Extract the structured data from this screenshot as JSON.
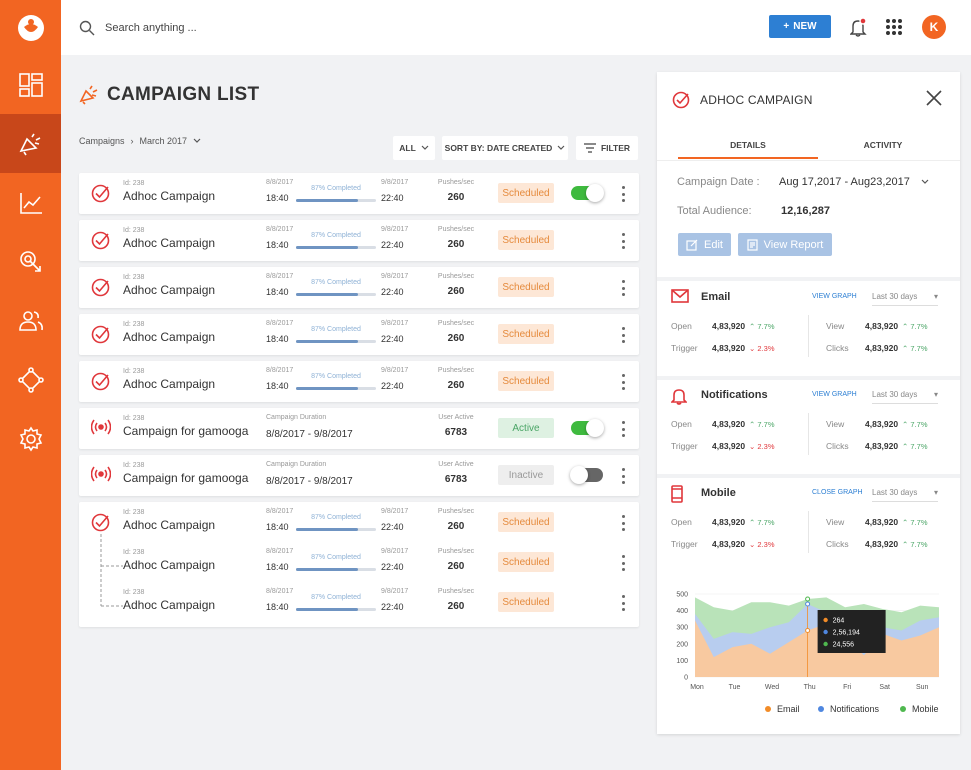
{
  "search": {
    "placeholder": "Search anything ..."
  },
  "header": {
    "new_label": "NEW",
    "avatar_initial": "K"
  },
  "page": {
    "title": "CAMPAIGN LIST"
  },
  "breadcrumb": {
    "root": "Campaigns",
    "current": "March 2017"
  },
  "filters": {
    "all_label": "ALL",
    "sort_label": "SORT BY: DATE CREATED",
    "filter_label": "FILTER"
  },
  "rows": [
    {
      "id": "Id: 238",
      "name": "Adhoc Campaign",
      "start_date": "8/8/2017",
      "start_time": "18:40",
      "progress_text": "87% Completed",
      "progress": 0.78,
      "end_date": "9/8/2017",
      "end_time": "22:40",
      "metric_label": "Pushes/sec",
      "metric_value": "260",
      "status": "Scheduled"
    },
    {
      "id": "Id: 238",
      "name": "Adhoc Campaign",
      "start_date": "8/8/2017",
      "start_time": "18:40",
      "progress_text": "87% Completed",
      "progress": 0.78,
      "end_date": "9/8/2017",
      "end_time": "22:40",
      "metric_label": "Pushes/sec",
      "metric_value": "260",
      "status": "Scheduled"
    },
    {
      "id": "Id: 238",
      "name": "Adhoc Campaign",
      "start_date": "8/8/2017",
      "start_time": "18:40",
      "progress_text": "87% Completed",
      "progress": 0.78,
      "end_date": "9/8/2017",
      "end_time": "22:40",
      "metric_label": "Pushes/sec",
      "metric_value": "260",
      "status": "Scheduled"
    },
    {
      "id": "Id: 238",
      "name": "Adhoc Campaign",
      "start_date": "8/8/2017",
      "start_time": "18:40",
      "progress_text": "87% Completed",
      "progress": 0.78,
      "end_date": "9/8/2017",
      "end_time": "22:40",
      "metric_label": "Pushes/sec",
      "metric_value": "260",
      "status": "Scheduled"
    },
    {
      "id": "Id: 238",
      "name": "Adhoc Campaign",
      "start_date": "8/8/2017",
      "start_time": "18:40",
      "progress_text": "87% Completed",
      "progress": 0.78,
      "end_date": "9/8/2017",
      "end_time": "22:40",
      "metric_label": "Pushes/sec",
      "metric_value": "260",
      "status": "Scheduled"
    },
    {
      "id": "Id: 238",
      "name": "Campaign for gamooga",
      "duration_label": "Campaign Duration",
      "duration": "8/8/2017 - 9/8/2017",
      "metric_label": "User Active",
      "metric_value": "6783",
      "status": "Active"
    },
    {
      "id": "Id: 238",
      "name": "Campaign for gamooga",
      "duration_label": "Campaign Duration",
      "duration": "8/8/2017 - 9/8/2017",
      "metric_label": "User Active",
      "metric_value": "6783",
      "status": "Inactive"
    }
  ],
  "group_rows": [
    {
      "id": "Id: 238",
      "name": "Adhoc Campaign",
      "start_date": "8/8/2017",
      "start_time": "18:40",
      "progress_text": "87% Completed",
      "progress": 0.78,
      "end_date": "9/8/2017",
      "end_time": "22:40",
      "metric_label": "Pushes/sec",
      "metric_value": "260",
      "status": "Scheduled"
    },
    {
      "id": "Id: 238",
      "name": "Adhoc Campaign",
      "start_date": "8/8/2017",
      "start_time": "18:40",
      "progress_text": "87% Completed",
      "progress": 0.78,
      "end_date": "9/8/2017",
      "end_time": "22:40",
      "metric_label": "Pushes/sec",
      "metric_value": "260",
      "status": "Scheduled"
    },
    {
      "id": "Id: 238",
      "name": "Adhoc Campaign",
      "start_date": "8/8/2017",
      "start_time": "18:40",
      "progress_text": "87% Completed",
      "progress": 0.78,
      "end_date": "9/8/2017",
      "end_time": "22:40",
      "metric_label": "Pushes/sec",
      "metric_value": "260",
      "status": "Scheduled"
    }
  ],
  "panel": {
    "title": "ADHOC CAMPAIGN",
    "tab_details": "DETAILS",
    "tab_activity": "ACTIVITY",
    "campaign_date_label": "Campaign Date :",
    "campaign_date_value": "Aug 17,2017 - Aug23,2017",
    "audience_label": "Total Audience:",
    "audience_value": "12,16,287",
    "edit_label": "Edit",
    "report_label": "View Report",
    "sections": [
      {
        "name": "Email",
        "link": "VIEW GRAPH",
        "period": "Last 30 days",
        "metrics": [
          {
            "label": "Open",
            "value": "4,83,920",
            "change": "7.7%"
          },
          {
            "label": "Trigger",
            "value": "4,83,920",
            "change": "2.3%"
          },
          {
            "label": "View",
            "value": "4,83,920",
            "change": "7.7%"
          },
          {
            "label": "Clicks",
            "value": "4,83,920",
            "change": "7.7%"
          }
        ]
      },
      {
        "name": "Notifications",
        "link": "VIEW GRAPH",
        "period": "Last 30 days",
        "metrics": [
          {
            "label": "Open",
            "value": "4,83,920",
            "change": "7.7%"
          },
          {
            "label": "Trigger",
            "value": "4,83,920",
            "change": "2.3%"
          },
          {
            "label": "View",
            "value": "4,83,920",
            "change": "7.7%"
          },
          {
            "label": "Clicks",
            "value": "4,83,920",
            "change": "7.7%"
          }
        ]
      },
      {
        "name": "Mobile",
        "link": "CLOSE GRAPH",
        "period": "Last 30 days",
        "metrics": [
          {
            "label": "Open",
            "value": "4,83,920",
            "change": "7.7%"
          },
          {
            "label": "Trigger",
            "value": "4,83,920",
            "change": "2.3%"
          },
          {
            "label": "View",
            "value": "4,83,920",
            "change": "7.7%"
          },
          {
            "label": "Clicks",
            "value": "4,83,920",
            "change": "7.7%"
          }
        ]
      }
    ]
  },
  "chart_data": {
    "type": "area",
    "categories": [
      "Mon",
      "Tue",
      "Wed",
      "Thu",
      "Fri",
      "Sat",
      "Sun"
    ],
    "y_ticks": [
      "0",
      "100",
      "200",
      "300",
      "400",
      "500"
    ],
    "ylim": [
      0,
      500
    ],
    "x": [
      0,
      0.5,
      1,
      1.5,
      2,
      2.5,
      3,
      3.5,
      4,
      4.5,
      5,
      5.5,
      6,
      6.5
    ],
    "series": [
      {
        "name": "Mobile",
        "color": "#b9e3b9",
        "values": [
          480,
          420,
          400,
          450,
          450,
          430,
          470,
          480,
          420,
          440,
          410,
          390,
          430,
          420
        ]
      },
      {
        "name": "Notifications",
        "color": "#b8cdef",
        "values": [
          380,
          230,
          270,
          260,
          300,
          330,
          440,
          390,
          380,
          330,
          300,
          280,
          340,
          360
        ]
      },
      {
        "name": "Email",
        "color": "#f8c9a0",
        "values": [
          340,
          120,
          180,
          200,
          140,
          210,
          280,
          320,
          250,
          130,
          260,
          220,
          250,
          300
        ]
      }
    ],
    "tooltip": [
      "264",
      "2,56,194",
      "24,556"
    ]
  },
  "colors": {
    "brand": "#f26522",
    "primary": "#2d7fd3",
    "green": "#3fba3f",
    "red": "#e0373b"
  }
}
